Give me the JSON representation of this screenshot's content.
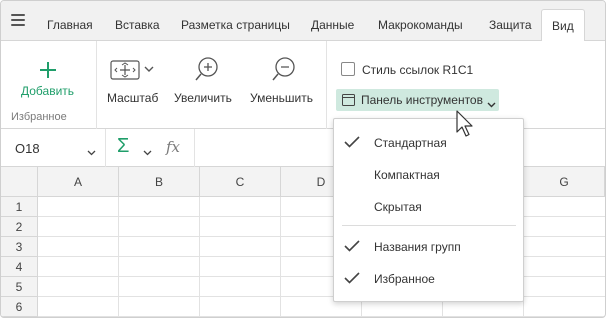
{
  "tabs": [
    {
      "label": "Главная"
    },
    {
      "label": "Вставка"
    },
    {
      "label": "Разметка страницы"
    },
    {
      "label": "Данные"
    },
    {
      "label": "Макрокоманды"
    },
    {
      "label": "Защита"
    },
    {
      "label": "Вид",
      "active": true
    }
  ],
  "ribbon": {
    "favorites_group": {
      "add_label": "Добавить",
      "group_label": "Избранное"
    },
    "zoom_group": {
      "scale_label": "Масштаб",
      "zoom_in_label": "Увеличить",
      "zoom_out_label": "Уменьшить"
    },
    "ref_style": {
      "label": "Стиль ссылок R1C1",
      "checked": false
    },
    "toolbar_button": {
      "label": "Панель инструментов"
    }
  },
  "formula_bar": {
    "cell_ref": "O18",
    "sum_symbol": "Σ",
    "fx_symbol": "fx",
    "value": ""
  },
  "grid": {
    "columns": [
      "A",
      "B",
      "C",
      "D",
      "",
      "",
      "G"
    ],
    "rows": [
      "1",
      "2",
      "3",
      "4",
      "5",
      "6"
    ]
  },
  "dropdown": {
    "items": [
      {
        "label": "Стандартная",
        "checked": true
      },
      {
        "label": "Компактная",
        "checked": false
      },
      {
        "label": "Скрытая",
        "checked": false
      },
      {
        "label": "Названия групп",
        "checked": true
      },
      {
        "label": "Избранное",
        "checked": true
      }
    ]
  },
  "colors": {
    "accent_green": "#1f9e6a",
    "selected_bg": "#cfe9df",
    "tabbar_bg": "#f1f1f1"
  }
}
